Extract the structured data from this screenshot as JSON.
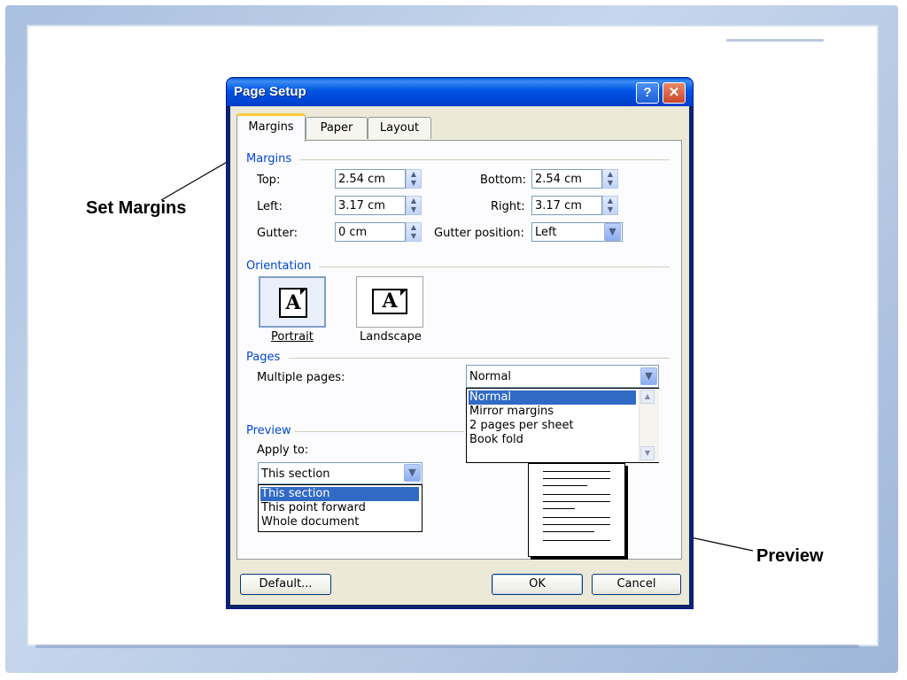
{
  "slide": {
    "callout_left": "Set Margins",
    "callout_right": "Preview"
  },
  "dialog": {
    "title": "Page Setup",
    "help_label": "?",
    "close_label": "✕",
    "tabs": [
      {
        "label": "Margins",
        "active": true
      },
      {
        "label": "Paper",
        "active": false
      },
      {
        "label": "Layout",
        "active": false
      }
    ],
    "margins_group": {
      "label": "Margins",
      "top_label": "Top:",
      "top_value": "2.54 cm",
      "bottom_label": "Bottom:",
      "bottom_value": "2.54 cm",
      "left_label": "Left:",
      "left_value": "3.17 cm",
      "right_label": "Right:",
      "right_value": "3.17 cm",
      "gutter_label": "Gutter:",
      "gutter_value": "0 cm",
      "gutter_position_label": "Gutter position:",
      "gutter_position_value": "Left"
    },
    "orientation_group": {
      "label": "Orientation",
      "portrait_label": "Portrait",
      "landscape_label": "Landscape",
      "icon_letter": "A",
      "selected": "Portrait"
    },
    "pages_group": {
      "label": "Pages",
      "multiple_pages_label": "Multiple pages:",
      "selected_value": "Normal",
      "options": [
        "Normal",
        "Mirror margins",
        "2 pages per sheet",
        "Book fold"
      ],
      "selected_index": 0
    },
    "preview_group": {
      "label": "Preview",
      "apply_to_label": "Apply to:",
      "apply_to_value": "This section",
      "options": [
        "This section",
        "This point forward",
        "Whole document"
      ],
      "selected_index": 0
    },
    "buttons": {
      "default_label": "Default...",
      "ok_label": "OK",
      "cancel_label": "Cancel"
    }
  },
  "colors": {
    "title_bar": "#0054e3",
    "selection": "#316ac5",
    "group_label": "#0046d5",
    "dialog_face": "#ece9d8",
    "active_tab_accent": "#ffc83d"
  }
}
